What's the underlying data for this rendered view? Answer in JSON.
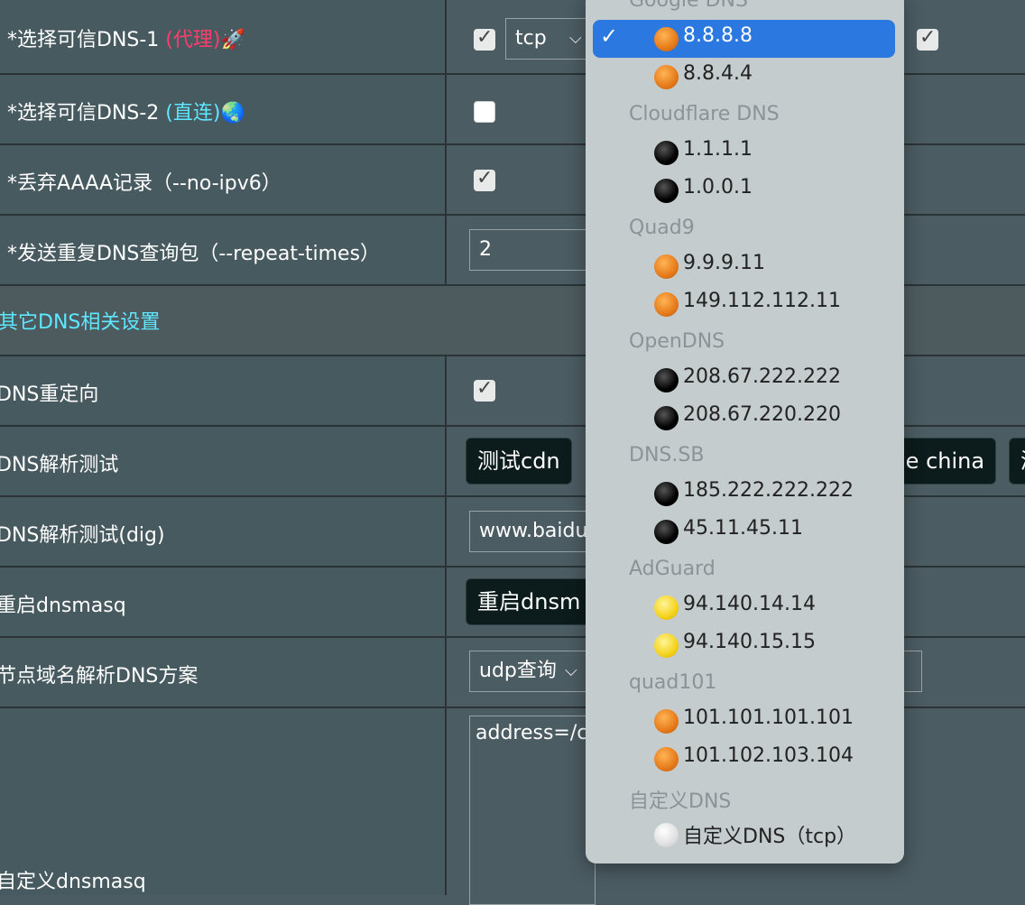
{
  "rows": {
    "dns1": {
      "label_prefix": "*选择可信DNS-1 ",
      "tag": "(代理)",
      "emoji": "🚀",
      "protocol": "tcp",
      "checked": true
    },
    "dns2": {
      "label_prefix": "*选择可信DNS-2 ",
      "tag": "(直连)",
      "emoji": "🌏",
      "checked": false
    },
    "no_ipv6": {
      "label": "*丢弃AAAA记录（--no-ipv6）",
      "checked": true
    },
    "repeat": {
      "label": "*发送重复DNS查询包（--repeat-times）",
      "value": "2"
    },
    "section": {
      "title": "其它DNS相关设置"
    },
    "redirect": {
      "label": "DNS重定向",
      "checked": true
    },
    "test": {
      "label": "DNS解析测试",
      "btn1": "测试cdn",
      "btn2": "le china",
      "btn3": "测"
    },
    "dig": {
      "label": "DNS解析测试(dig)",
      "value": "www.baidu"
    },
    "restart": {
      "label": "重启dnsmasq",
      "btn": "重启dnsm"
    },
    "node_dns": {
      "label": "节点域名解析DNS方案",
      "value": "udp查询"
    },
    "custom": {
      "label": "自定义dnsmasq",
      "value": "address=/c"
    }
  },
  "dropdown": {
    "groups": [
      {
        "label": "Google DNS",
        "options": [
          {
            "text": "8.8.8.8",
            "dot": "orange",
            "selected": true
          },
          {
            "text": "8.8.4.4",
            "dot": "orange"
          }
        ]
      },
      {
        "label": "Cloudflare DNS",
        "options": [
          {
            "text": "1.1.1.1",
            "dot": "black"
          },
          {
            "text": "1.0.0.1",
            "dot": "black"
          }
        ]
      },
      {
        "label": "Quad9",
        "options": [
          {
            "text": "9.9.9.11",
            "dot": "orange"
          },
          {
            "text": "149.112.112.11",
            "dot": "orange"
          }
        ]
      },
      {
        "label": "OpenDNS",
        "options": [
          {
            "text": "208.67.222.222",
            "dot": "black"
          },
          {
            "text": "208.67.220.220",
            "dot": "black"
          }
        ]
      },
      {
        "label": "DNS.SB",
        "options": [
          {
            "text": "185.222.222.222",
            "dot": "black"
          },
          {
            "text": "45.11.45.11",
            "dot": "black"
          }
        ]
      },
      {
        "label": "AdGuard",
        "options": [
          {
            "text": "94.140.14.14",
            "dot": "yellow"
          },
          {
            "text": "94.140.15.15",
            "dot": "yellow"
          }
        ]
      },
      {
        "label": "quad101",
        "options": [
          {
            "text": "101.101.101.101",
            "dot": "orange"
          },
          {
            "text": "101.102.103.104",
            "dot": "orange"
          }
        ]
      },
      {
        "label": "自定义DNS",
        "options": [
          {
            "text": "自定义DNS（tcp）",
            "dot": "white"
          }
        ]
      }
    ]
  },
  "icons": {
    "checkmark": "checkmark-icon",
    "chevron": "chevron-down-icon"
  }
}
